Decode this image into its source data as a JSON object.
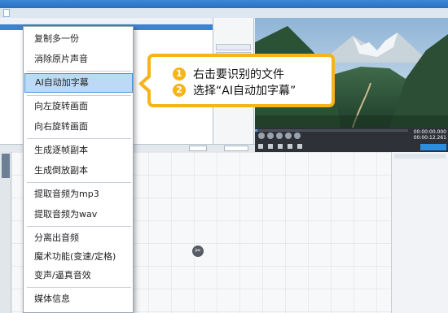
{
  "context_menu": {
    "items": [
      {
        "label": "复制多一份"
      },
      {
        "label": "消除原片声音"
      },
      {
        "label": "AI自动加字幕"
      },
      {
        "label": "向左旋转画面"
      },
      {
        "label": "向右旋转画面"
      },
      {
        "label": "生成逐帧副本"
      },
      {
        "label": "生成倒放副本"
      },
      {
        "label": "提取音频为mp3"
      },
      {
        "label": "提取音频为wav"
      },
      {
        "label": "分离出音频"
      },
      {
        "label": "魔术功能(变速/定格)"
      },
      {
        "label": "变声/逼真音效"
      },
      {
        "label": "媒体信息"
      }
    ]
  },
  "callout": {
    "step1_number": "1",
    "step1_text": "右击要识别的文件",
    "step2_number": "2",
    "step2_text": "选择“AI自动加字幕”"
  },
  "player": {
    "time_current": "00:00:00.000",
    "time_total": "00:00:12.261"
  },
  "colors": {
    "callout_border": "#f6b31a",
    "menu_highlight": "#bcd9f5",
    "menu_highlight_border": "#4a8fd6"
  }
}
